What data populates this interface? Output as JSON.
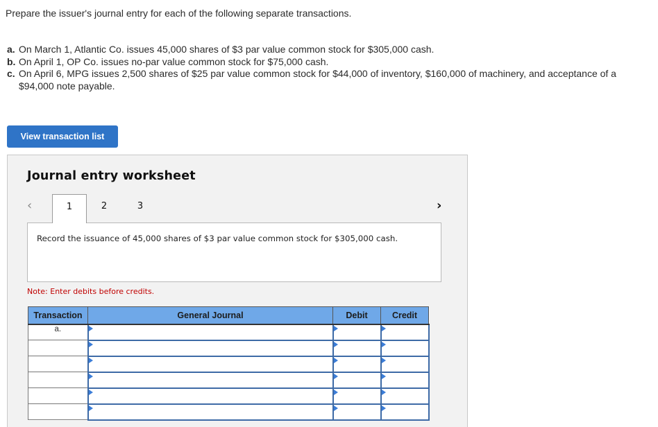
{
  "intro": "Prepare the issuer's journal entry for each of the following separate transactions.",
  "transactions": [
    {
      "letter": "a.",
      "text": "On March 1, Atlantic Co. issues 45,000 shares of $3 par value common stock for $305,000 cash."
    },
    {
      "letter": "b.",
      "text": "On April 1, OP Co. issues no-par value common stock for $75,000 cash."
    },
    {
      "letter": "c.",
      "text": "On April 6, MPG issues 2,500 shares of $25 par value common stock for $44,000 of inventory, $160,000 of machinery, and acceptance of a $94,000 note payable."
    }
  ],
  "view_button_label": "View transaction list",
  "worksheet": {
    "title": "Journal entry worksheet",
    "prev_icon": "‹",
    "next_icon": "›",
    "tabs": [
      {
        "label": "1",
        "active": true
      },
      {
        "label": "2",
        "active": false
      },
      {
        "label": "3",
        "active": false
      }
    ],
    "instruction": "Record the issuance of 45,000 shares of $3 par value common stock for $305,000 cash.",
    "note": "Note: Enter debits before credits.",
    "table": {
      "headers": {
        "transaction": "Transaction",
        "general_journal": "General Journal",
        "debit": "Debit",
        "credit": "Credit"
      },
      "rows": [
        {
          "transaction": "a.",
          "general_journal": "",
          "debit": "",
          "credit": ""
        },
        {
          "transaction": "",
          "general_journal": "",
          "debit": "",
          "credit": ""
        },
        {
          "transaction": "",
          "general_journal": "",
          "debit": "",
          "credit": ""
        },
        {
          "transaction": "",
          "general_journal": "",
          "debit": "",
          "credit": ""
        },
        {
          "transaction": "",
          "general_journal": "",
          "debit": "",
          "credit": ""
        },
        {
          "transaction": "",
          "general_journal": "",
          "debit": "",
          "credit": ""
        }
      ]
    }
  },
  "colors": {
    "button": "#2f74c7",
    "header": "#6fa8e8",
    "note": "#c00000",
    "input_border": "#3d6aa6"
  }
}
